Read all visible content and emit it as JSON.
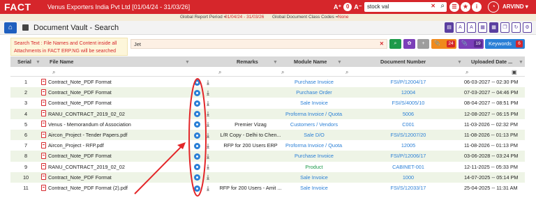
{
  "app": {
    "logo": "FACT",
    "company": "Venus Exporters India Pvt Ltd [01/04/24 - 31/03/26]",
    "user": "ARVIND"
  },
  "topbar": {
    "search_value": "stock val",
    "font_up": "A⁺",
    "font_down": "A⁻",
    "badge": "0",
    "colors": {
      "bar": "#d6262b"
    }
  },
  "subbar": {
    "period_label": "Global Report Period =",
    "period_value": "01/04/24 - 31/03/26",
    "class_label": "Global Document Class Codes =",
    "class_value": "None"
  },
  "title": {
    "text": "Document Vault - Search"
  },
  "search": {
    "note": "Search Text : File Names and Content inside all Attachments in FACT ERP.NG will be searched",
    "value": "Jet",
    "count1": "24",
    "count2": "19",
    "keywords_label": "Keywords",
    "keywords_count": "6"
  },
  "table": {
    "headers": {
      "serial": "Serial",
      "file": "File Name",
      "remarks": "Remarks",
      "module": "Module Name",
      "docno": "Document Number",
      "uploaded": "Uploaded Date ..."
    },
    "rows": [
      {
        "serial": "1",
        "file": "Contract_Note_PDF Format",
        "remarks": "",
        "module": "Purchase Invoice",
        "docno": "FSI/P/12004/17",
        "date": "06-03-2027 -- 02:30 PM",
        "zebra": false,
        "color": "link"
      },
      {
        "serial": "2",
        "file": "Contract_Note_PDF Format",
        "remarks": "",
        "module": "Purchase Order",
        "docno": "12004",
        "date": "07-03-2027 -- 04:46 PM",
        "zebra": true,
        "color": "link"
      },
      {
        "serial": "3",
        "file": "Contract_Note_PDF Format",
        "remarks": "",
        "module": "Sale Invoice",
        "docno": "FSI/S/4005/10",
        "date": "08-04-2027 -- 08:51 PM",
        "zebra": false,
        "color": "link"
      },
      {
        "serial": "4",
        "file": "RANU_CONTRACT_2019_02_02",
        "remarks": "",
        "module": "Proforma Invoice / Quota...",
        "docno": "5006",
        "date": "12-08-2027 -- 06:15 PM",
        "zebra": true,
        "color": "link"
      },
      {
        "serial": "5",
        "file": "Venus - Memorandum of Association",
        "remarks": "Premier Vizag",
        "module": "Customers / Vendors",
        "docno": "C001",
        "date": "11-03-2026 -- 02:32 PM",
        "zebra": false,
        "color": "link"
      },
      {
        "serial": "6",
        "file": "Aircon_Project - Tender Papers.pdf",
        "remarks": "L/R Copy - Delhi to Chen...",
        "module": "Sale D/O",
        "docno": "FSI/S/12007/20",
        "date": "11-08-2026 -- 01:13 PM",
        "zebra": true,
        "color": "link"
      },
      {
        "serial": "7",
        "file": "Aircon_Project - RFP.pdf",
        "remarks": "RFP for 200 Users ERP",
        "module": "Proforma Invoice / Quota...",
        "docno": "12005",
        "date": "11-08-2026 -- 01:13 PM",
        "zebra": false,
        "color": "link"
      },
      {
        "serial": "8",
        "file": "Contract_Note_PDF Format",
        "remarks": "",
        "module": "Purchase Invoice",
        "docno": "FSI/P/12006/17",
        "date": "03-06-2028 -- 03:24 PM",
        "zebra": true,
        "color": "link"
      },
      {
        "serial": "9",
        "file": "RANU_CONTRACT_2019_02_02",
        "remarks": "",
        "module": "Product",
        "docno": "CABINET-001",
        "date": "12-11-2025 -- 05:33 PM",
        "zebra": false,
        "color": "grn"
      },
      {
        "serial": "10",
        "file": "Contract_Note_PDF Format",
        "remarks": "",
        "module": "Sale Invoice",
        "docno": "1000",
        "date": "14-07-2025 -- 05:14 PM",
        "zebra": true,
        "color": "link"
      },
      {
        "serial": "11",
        "file": "Contract_Note_PDF Format (2).pdf",
        "remarks": "RFP for 200 Users - Amit ...",
        "module": "Sale Invoice",
        "docno": "FSI/S/12033/17",
        "date": "25-04-2025 -- 11:31 AM",
        "zebra": false,
        "color": "link"
      }
    ]
  }
}
